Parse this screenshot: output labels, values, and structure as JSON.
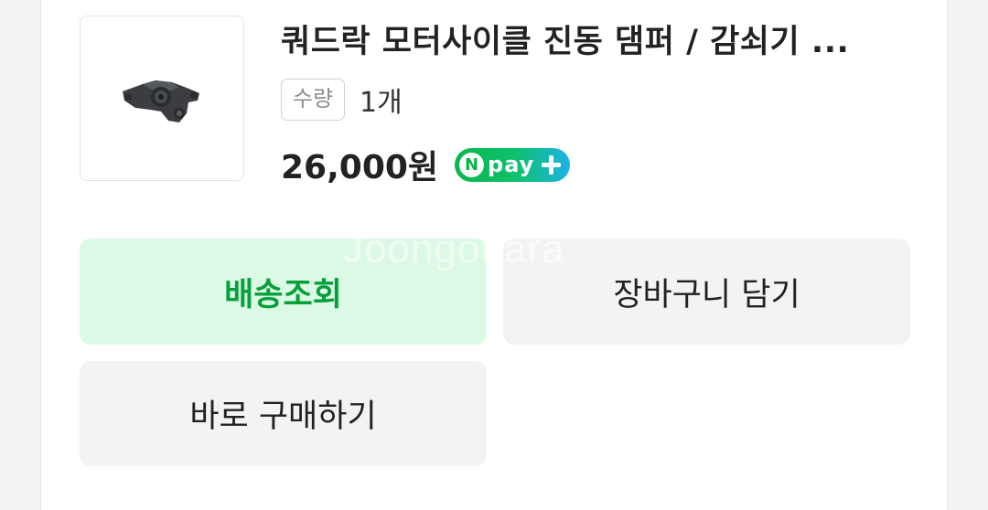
{
  "product": {
    "title": "쿼드락 모터사이클 진동 댐퍼 / 감쇠기 ...",
    "quantity_label": "수량",
    "quantity_value": "1개",
    "price": "26,000원",
    "npay": {
      "n": "N",
      "text": "pay",
      "icon": "plus-icon"
    }
  },
  "actions": {
    "shipping_label": "배송조회",
    "cart_label": "장바구니 담기",
    "buy_label": "바로 구매하기"
  },
  "watermark": "Joongonara",
  "colors": {
    "shipping_bg": "#dcf9e6",
    "shipping_text": "#05a03a",
    "button_bg": "#f2f3f4",
    "npay_green": "#08b84a",
    "npay_blue": "#1cb3e8"
  }
}
